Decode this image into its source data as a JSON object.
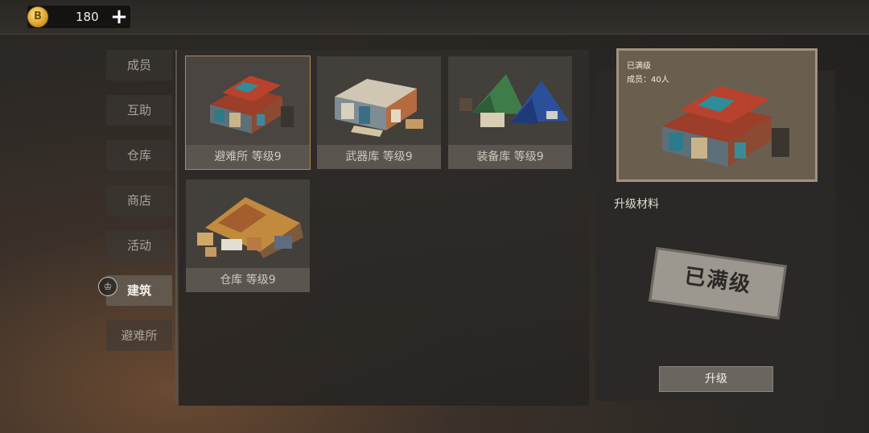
{
  "topbar": {
    "coin_symbol": "B",
    "coin_count": "180",
    "plus_symbol": "+"
  },
  "sidebar": {
    "items": [
      {
        "label": "成员"
      },
      {
        "label": "互助"
      },
      {
        "label": "仓库"
      },
      {
        "label": "商店"
      },
      {
        "label": "活动"
      },
      {
        "label": "建筑"
      },
      {
        "label": "避难所"
      }
    ],
    "active_icon_symbol": "♔"
  },
  "buildings": [
    {
      "label": "避难所 等级9",
      "icon": "shelter-icon"
    },
    {
      "label": "武器库 等级9",
      "icon": "armory-icon"
    },
    {
      "label": "装备库 等级9",
      "icon": "tent-icon"
    },
    {
      "label": "仓库 等级9",
      "icon": "warehouse-icon"
    }
  ],
  "detail": {
    "status": "已满级",
    "members": "成员：40人",
    "materials_title": "升级材料",
    "stamp_text": "已满级",
    "upgrade_label": "升级"
  },
  "colors": {
    "accent": "#b58a4c",
    "coin": "#d69a1d"
  }
}
